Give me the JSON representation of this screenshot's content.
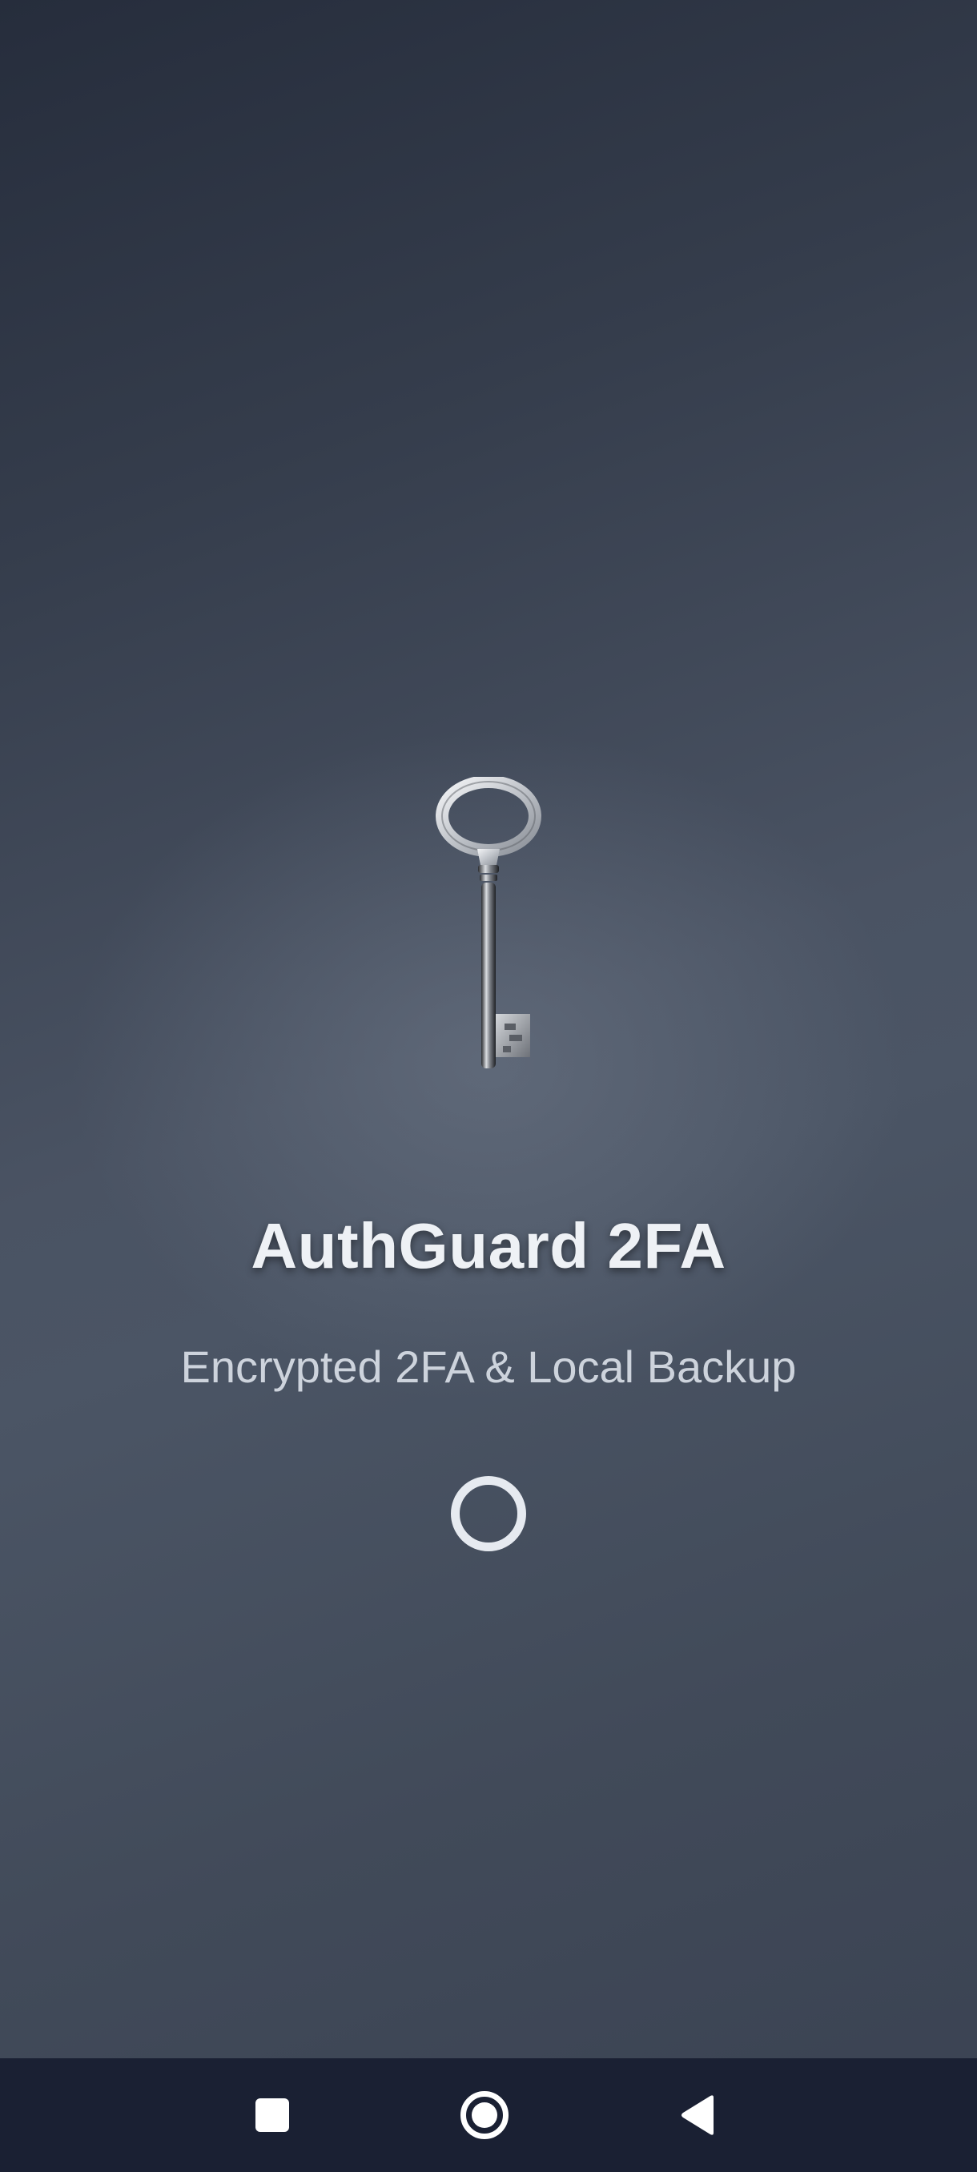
{
  "splash": {
    "title": "AuthGuard 2FA",
    "subtitle": "Encrypted 2FA & Local Backup",
    "logo_icon": "old-key-icon",
    "loading_indicator": "spinner-ring"
  },
  "nav_bar": {
    "buttons": [
      {
        "name": "recents",
        "icon": "square-icon"
      },
      {
        "name": "home",
        "icon": "circle-home-icon"
      },
      {
        "name": "back",
        "icon": "triangle-back-icon"
      }
    ]
  },
  "colors": {
    "background_top": "#262d3c",
    "background_mid": "#4a5363",
    "title": "#eef1f5",
    "subtitle": "#cdd3dc",
    "nav_bar": "#1a2033"
  }
}
